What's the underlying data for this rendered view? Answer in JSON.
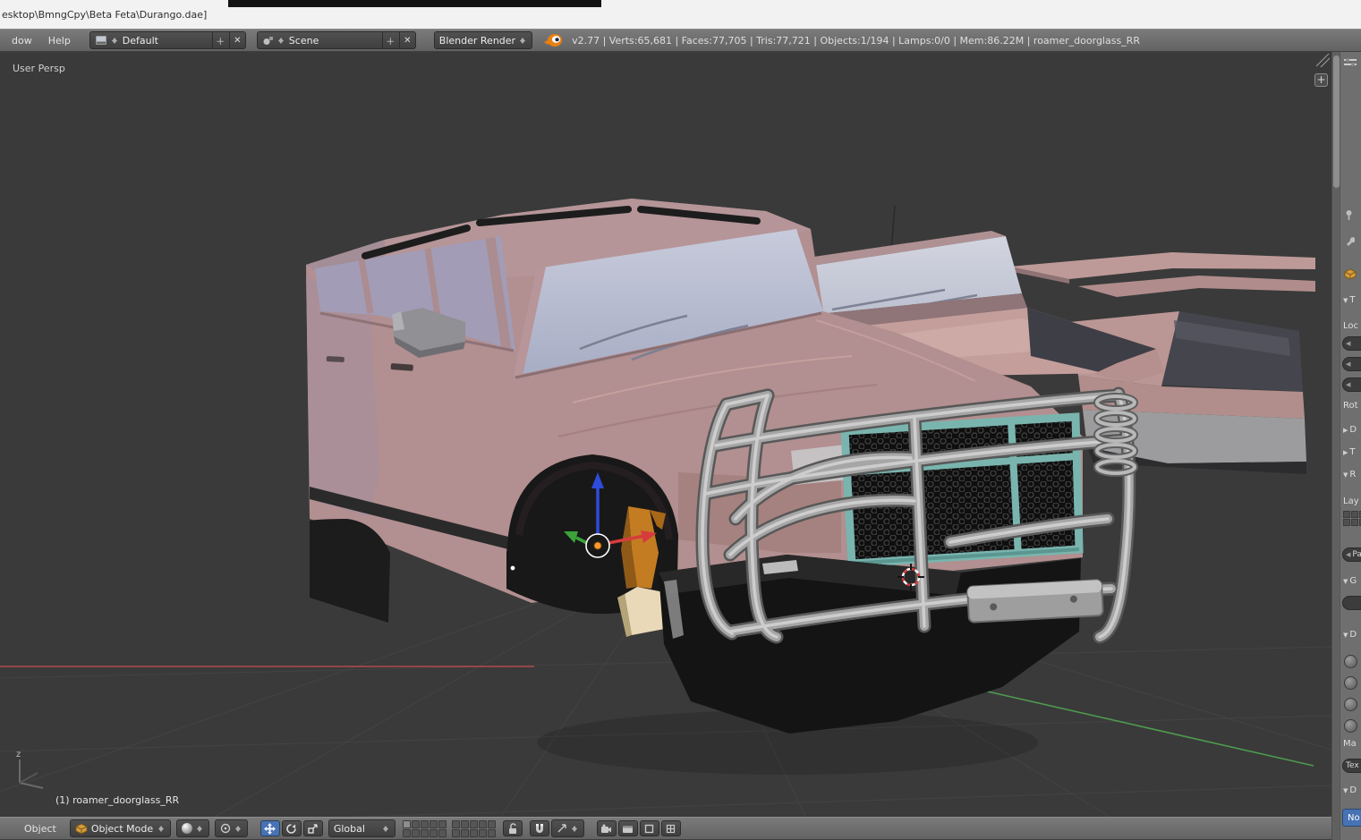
{
  "titlebar": {
    "title": "esktop\\BmngCpy\\Beta Feta\\Durango.dae]"
  },
  "header": {
    "menus": {
      "window": "dow",
      "help": "Help"
    },
    "layout": {
      "value": "Default"
    },
    "scene": {
      "value": "Scene"
    },
    "engine": {
      "value": "Blender Render"
    },
    "stats": "v2.77 | Verts:65,681 | Faces:77,705 | Tris:77,721 | Objects:1/194 | Lamps:0/0 | Mem:86.22M | roamer_doorglass_RR"
  },
  "viewport": {
    "view_label": "User Persp",
    "active_object": "(1) roamer_doorglass_RR",
    "gizmo_z": "z"
  },
  "footer": {
    "object_menu": "Object",
    "mode": "Object Mode",
    "orientation": "Global"
  },
  "properties": {
    "transform_header": "T",
    "location_label": "Loc",
    "rotation_label": "Rot",
    "delta_header": "D",
    "locks_header": "T",
    "relations_header": "R",
    "layers_label": "Lay",
    "parent_value": "Pa",
    "groups_header": "G",
    "display_header": "D",
    "max_label": "Ma",
    "tex_value": "Tex",
    "duplication_header": "D",
    "none_button": "No"
  },
  "colors": {
    "accent_blue": "#4772b3",
    "body_pink": "#b5918f",
    "grille_teal": "#7ab6b0",
    "axis_x": "#b04a4a",
    "axis_y": "#4e9a4e",
    "axis_z": "#2e4bdb",
    "viewport_bg": "#3a3a3a"
  }
}
